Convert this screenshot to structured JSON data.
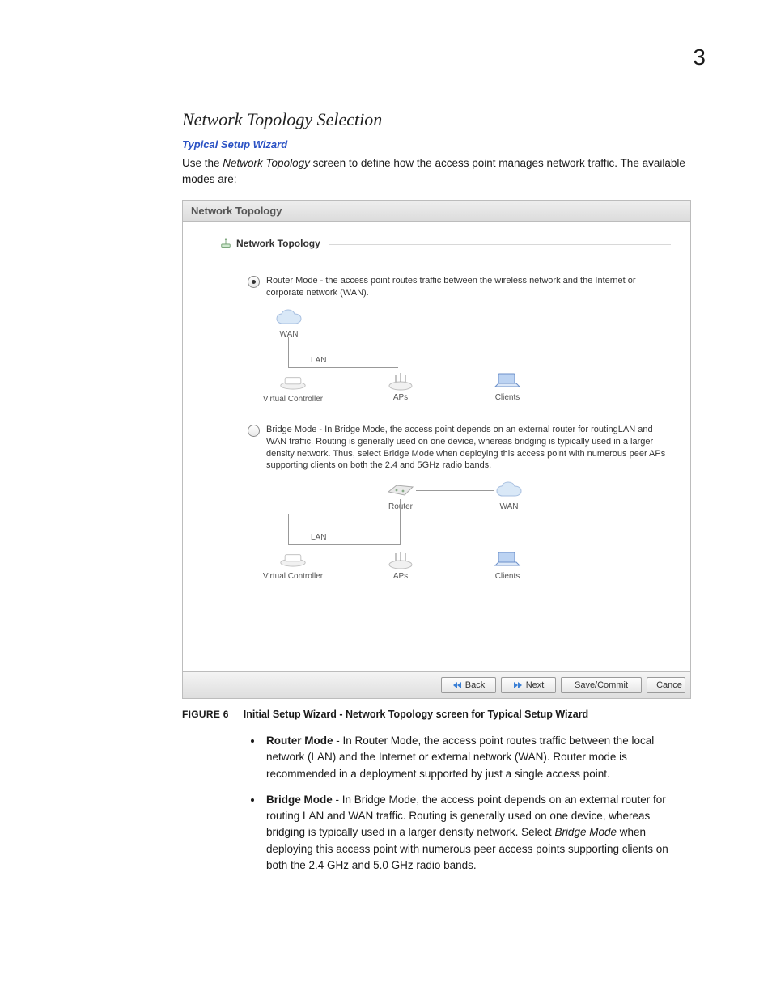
{
  "page_number": "3",
  "section_title": "Network Topology Selection",
  "wizard_link": "Typical Setup Wizard",
  "intro_prefix": "Use the ",
  "intro_em": "Network Topology",
  "intro_suffix": " screen to define how the access point manages network traffic. The available modes are:",
  "panel": {
    "title": "Network Topology",
    "fieldset_label": "Network Topology",
    "router_mode": {
      "text": "Router Mode - the access point routes traffic between the wireless network and the Internet or corporate network (WAN).",
      "labels": {
        "wan": "WAN",
        "lan": "LAN",
        "vc": "Virtual Controller",
        "aps": "APs",
        "clients": "Clients"
      }
    },
    "bridge_mode": {
      "text": "Bridge Mode - In Bridge Mode, the access point depends on an external router for routingLAN and WAN traffic. Routing is generally used on one device, whereas bridging is typically used in a larger density network. Thus, select Bridge Mode when deploying this access point with numerous peer APs supporting clients on both the 2.4 and 5GHz radio bands.",
      "labels": {
        "router": "Router",
        "wan": "WAN",
        "lan": "LAN",
        "vc": "Virtual Controller",
        "aps": "APs",
        "clients": "Clients"
      }
    },
    "buttons": {
      "back": "Back",
      "next": "Next",
      "save": "Save/Commit",
      "cancel": "Cance"
    }
  },
  "figure": {
    "label": "FIGURE 6",
    "caption": "Initial Setup Wizard - Network Topology screen for Typical Setup Wizard"
  },
  "bullets": {
    "router": {
      "head": "Router Mode",
      "body": " - In Router Mode, the access point routes traffic between the local network (LAN) and the Internet or external network (WAN). Router mode is recommended in a deployment supported by just a single access point."
    },
    "bridge": {
      "head": "Bridge Mode",
      "body_prefix": " - In Bridge Mode, the access point depends on an external router for routing LAN and WAN traffic. Routing is generally used on one device, whereas bridging is typically used in a larger density network. Select ",
      "body_em": "Bridge Mode",
      "body_suffix": " when deploying this access point with numerous peer access points supporting clients on both the 2.4 GHz and 5.0 GHz radio bands."
    }
  }
}
